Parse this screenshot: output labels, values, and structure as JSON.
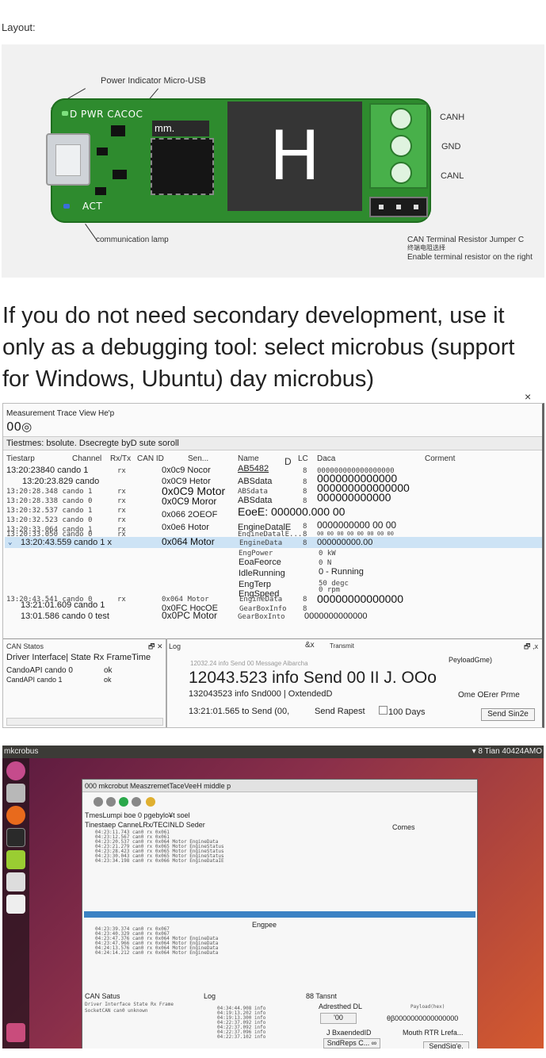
{
  "layout_label": "Layout:",
  "board": {
    "callouts": {
      "top": "Power Indicator Micro-USB",
      "bottom_left": "communication lamp",
      "canh": "CANH",
      "gnd": "GND",
      "canl": "CANL",
      "jumper": "CAN Terminal Resistor Jumper C",
      "jumper_cn": "终端电阻选择",
      "enable": "Enable terminal resistor on the right"
    },
    "pcb_label_top": "D PWR CACOC",
    "pcb_label_act": "ACT",
    "chip_mark": "mm.",
    "h_mark": "H",
    "colors": {
      "pcb": "#2e8b2e",
      "terminal": "#48b04a",
      "led_green": "#7ee07e",
      "led_blue": "#3a6fd8"
    }
  },
  "intro_text": "If you do not need secondary development, use it only as a debugging tool: select microbus (support for Windows, Ubuntu) day microbus)",
  "win_app": {
    "close": "×",
    "menu": "Measurement Trace View He'p",
    "toolbar_value": "00◎",
    "filter_line": "Tiestmes: bsolute. Dsecregte byD sute soroll",
    "headers": [
      "Tiestarp",
      "Channel",
      "Rx/Tx",
      "CAN ID",
      "Sen...",
      "Name",
      "D",
      "LC",
      "Daca",
      "Corment"
    ],
    "rows": [
      {
        "time": "13:20:23840 cando 1",
        "rx": "rx",
        "id": "0x0c9 Nocor",
        "name": "AB5482",
        "dlc": "8",
        "data": "000000000000000000"
      },
      {
        "time": "13:20:23.829 cando",
        "rx": "",
        "id": "0x0C9 Hetor",
        "name": "ABSdata",
        "dlc": "8",
        "data": "0000000000000"
      },
      {
        "time": "13:20:28.348 cando 1",
        "rx": "rx",
        "id": "0x0C9 Motor",
        "name": "ABSdata",
        "dlc": "8",
        "data": "000000000000000"
      },
      {
        "time": "13:20:28.338 cando 0",
        "rx": "rx",
        "id": "0x0C9 Moror",
        "name": "ABSdata",
        "dlc": "8",
        "data": "000000000000"
      },
      {
        "time": "13:20:32.537 cando 1",
        "rx": "rx",
        "id": "0x066 2OEOF",
        "name": "EoeE: 000000.000 00",
        "dlc": "",
        "data": ""
      },
      {
        "time": "13:20:32.523 cando 0",
        "rx": "rx",
        "id": "",
        "name": "",
        "dlc": "",
        "data": ""
      },
      {
        "time": "13:20:33.064 cando 1",
        "rx": "rx",
        "id": "0x0e6 Hotor",
        "name": "EngineDatalE",
        "dlc": "8",
        "data": "0000000000 00 00"
      },
      {
        "time": "13:20:33.050 cando 0",
        "rx": "rx",
        "id": "",
        "name": "EngineDatalE...",
        "dlc": "8",
        "data": "00 00 00 00 00 00 00 00"
      }
    ],
    "selected_row": {
      "time": "13:20:43.559 cando 1 x",
      "id": "0x064 Motor",
      "name": "EngineData",
      "dlc": "8",
      "data": "000000000.00"
    },
    "signals": [
      {
        "name": "EngPower",
        "value": "0 kW"
      },
      {
        "name": "EoaFeorce",
        "value": "0 N"
      },
      {
        "name": "IdleRunning",
        "value": "0 - Running"
      },
      {
        "name": "EngTerp",
        "value": "50 degc"
      },
      {
        "name": "EngSpeed",
        "value": "0 rpm"
      }
    ],
    "rows_after": [
      {
        "time": "13:20:43.541 cando 0",
        "rx": "rx",
        "id": "0x064 Motor",
        "name": "EngineData",
        "dlc": "8",
        "data": "00000000000000"
      },
      {
        "time": "13:21:01.609 cando 1",
        "rx": "",
        "id": "0x0FC HocOE",
        "name": "GearBoxInfo",
        "dlc": "8",
        "data": ""
      },
      {
        "time": "13:01.586 cando 0 test",
        "rx": "",
        "id": "0x0PC Motor",
        "name": "GearBoxInto",
        "dlc": "",
        "data": "0000000000000"
      }
    ],
    "can_status": {
      "title": "CAN Statos",
      "header": "Driver Interface| State Rx FrameTime",
      "items": [
        {
          "name": "CandoAPI cando 0",
          "state": "ok"
        },
        {
          "name": "CandAPI cando 1",
          "state": "ok"
        }
      ]
    },
    "log": {
      "title": "Log",
      "close": "&x",
      "faded": "12032.24  info Send 00 Message Aibarcha",
      "line_big": "12043.523 info Send 00 II J. OOo",
      "line_small": "132043523  info Snd000 | OxtendedD",
      "line_send": "13:21:01.565  to Send (00,",
      "send_rapest": "Send Rapest",
      "days": "100 Days"
    },
    "transmit": {
      "title": "Transmit",
      "payload": "PeyloadGme)",
      "other": "Ome OErer Prme",
      "send_button": "Send Sin2e"
    }
  },
  "ubuntu": {
    "topbar_left": "mkcrobus",
    "topbar_right": "▾ 8 Tian 40424AMO",
    "window_title": "000 mkcrobut MeaszremetTaceVeeH middle p",
    "filter": "TmesLumpi boe 0 pgebylo¥t soel",
    "header": "Tinestaep CanneLRx/TECINLD Seder",
    "comes": "Comes",
    "engpee": "Engpee",
    "status_title": "CAN Satus",
    "status_header": "Driver    Interface  State     Rx Frame",
    "status_row": "SocketCAN  can0    unknown",
    "log_title": "Log",
    "transmit_title": "88 Tansnt",
    "adresthed": "Adresthed DL",
    "input_val": "'00",
    "payload": "Payload(hex)",
    "payload_val": "θβ0000000000000000",
    "ext": "J BxaendedID",
    "rtr": "Mouth RTR Lrefa...",
    "reps": "SndReps C... ∞",
    "send": "SendSig'e,"
  }
}
